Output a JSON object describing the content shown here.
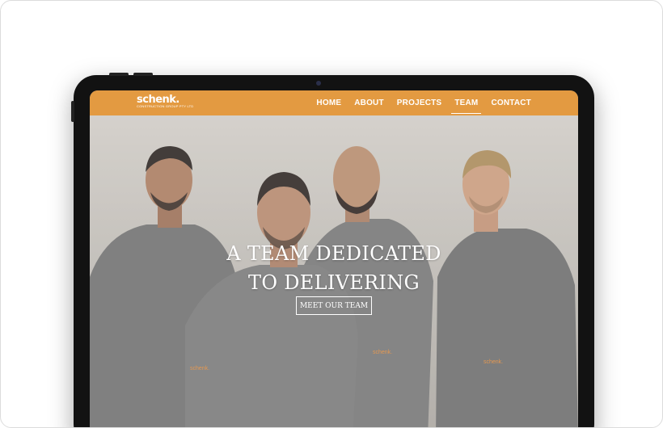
{
  "brand": {
    "name": "schenk.",
    "tagline": "CONSTRUCTION GROUP PTY LTD",
    "accent_color": "#e39a41"
  },
  "nav": {
    "items": [
      {
        "label": "HOME"
      },
      {
        "label": "ABOUT"
      },
      {
        "label": "PROJECTS"
      },
      {
        "label": "TEAM",
        "active": true
      },
      {
        "label": "CONTACT"
      }
    ]
  },
  "hero": {
    "title_line1": "A TEAM DEDICATED",
    "title_line2": "TO DELIVERING",
    "cta_label": "MEET OUR TEAM",
    "shirt_logo": "schenk."
  }
}
